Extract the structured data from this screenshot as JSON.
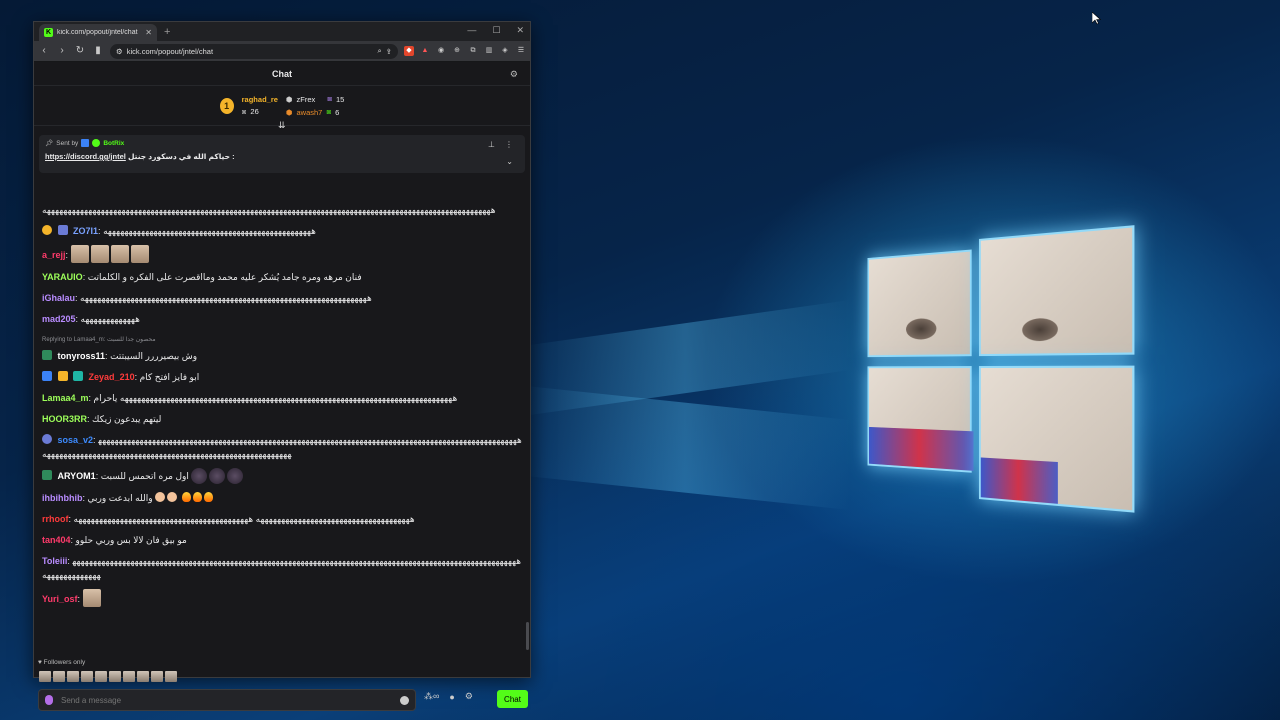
{
  "browser": {
    "tab_title": "kick.com/popout/jntel/chat",
    "url": "kick.com/popout/jntel/chat",
    "favicon_letter": "K"
  },
  "chat": {
    "header_title": "Chat",
    "leaderboard": {
      "rank": "1",
      "first_user": "raghad_re",
      "first_count": "26",
      "second_user": "zFrex",
      "second_count": "15",
      "third_user": "awash7",
      "third_count": "6"
    },
    "pinned": {
      "sent_by": "Sent by",
      "bot_name": "BotRix",
      "link": "https://discord.gg/jntel",
      "text": "حياكم الله في دسكورد جنتل :"
    },
    "messages": [
      {
        "user": "",
        "color": "#ffffff",
        "text": "ههههههههههههههههههههههههههههههههههههههههههههههههههههههههههههههههههههههههههههههههههههههههههههههههههههههههههههه"
      },
      {
        "user": "ZO7I1",
        "color": "#7aa2ff",
        "text": "ههههههههههههههههههههههههههههههههههههههههههههههههههه"
      },
      {
        "user": "a_rejj",
        "color": "#ff3b6b",
        "text": ""
      },
      {
        "user": "YARAUIO",
        "color": "#9dff5a",
        "text": "فنان مرهه ومره جامد يُشكر عليه محمد ومااقصرت على الفكره و الكلماتت"
      },
      {
        "user": "iGhalau",
        "color": "#b98cff",
        "text": "هههههههههههههههههههههههههههههههههههههههههههههههههههههههههههههههههههههه"
      },
      {
        "user": "mad205",
        "color": "#b98cff",
        "text": "هههههههههههههه"
      },
      {
        "user": "tonyross11",
        "color": "#ffffff",
        "text": "وش بيصيرررر السيبتتت",
        "reply": "Replying to Lamaa4_m: محصون جدا للسبت"
      },
      {
        "user": "Zeyad_210",
        "color": "#ff3b3b",
        "text": "ابو فايز افتح كام"
      },
      {
        "user": "Lamaa4_m",
        "color": "#9dff5a",
        "text": "ههههههههههههههههههههههههههههههههههههههههههههههههههههههههههههههههههههههههههههههههه ياحرام"
      },
      {
        "user": "HOOR3RR",
        "color": "#9dff5a",
        "text": "ليتهم يبدعون زيكك"
      },
      {
        "user": "sosa_v2",
        "color": "#3d8bff",
        "text": "هههههههههههههههههههههههههههههههههههههههههههههههههههههههههههههههههههههههههههههههههههههههههههههههههههههههههههههههههههههههههههههههههههههههههههههههههههههههههههههههههه"
      },
      {
        "user": "ARYOM1",
        "color": "#ffffff",
        "text": "اول مره اتحمس للسبت"
      },
      {
        "user": "ihbihbhib",
        "color": "#b98cff",
        "text": "والله ابدعت وربي"
      },
      {
        "user": "rrhoof",
        "color": "#ff3b3b",
        "text": "هههههههههههههههههههههههههههههههههههههه ههههههههههههههههههههههههههههههههههههههههههه"
      },
      {
        "user": "tan404",
        "color": "#ff3b6b",
        "text": "مو بيق فان لالا بس وربي حلوو"
      },
      {
        "user": "Toleiii",
        "color": "#b98cff",
        "text": "هههههههههههههههههههههههههههههههههههههههههههههههههههههههههههههههههههههههههههههههههههههههههههههههههههههههههههههههههههههههههه"
      },
      {
        "user": "Yuri_osf",
        "color": "#ff3b6b",
        "text": ""
      }
    ],
    "followers_only": "Followers only",
    "composer_placeholder": "Send a message",
    "send_label": "Chat"
  }
}
